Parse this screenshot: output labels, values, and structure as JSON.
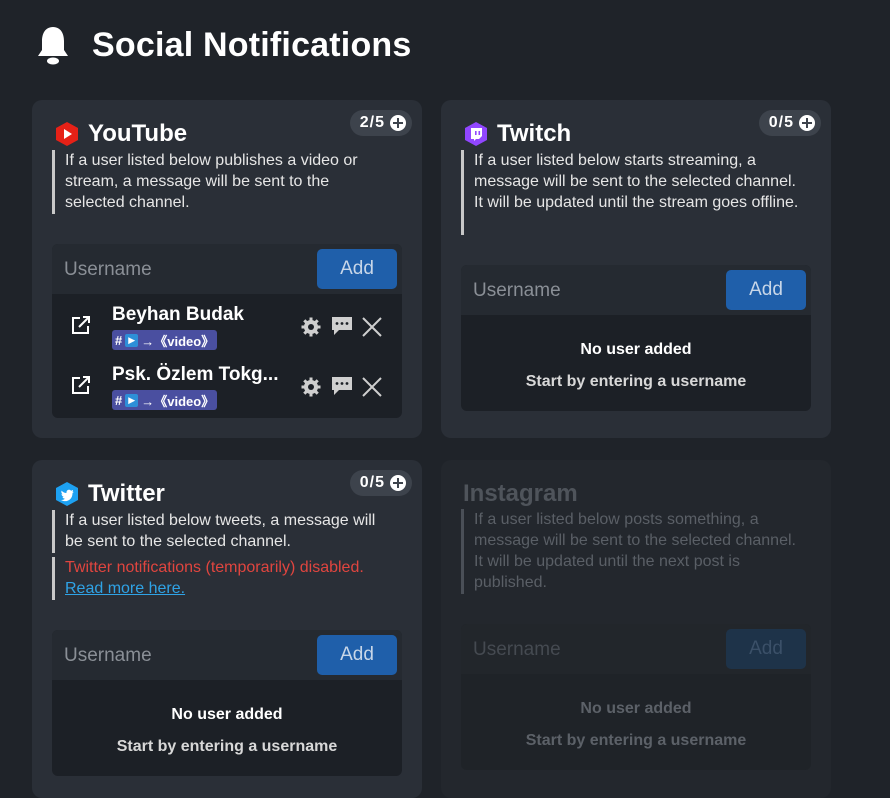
{
  "page": {
    "title": "Social Notifications"
  },
  "common": {
    "placeholder": "Username",
    "add_label": "Add",
    "empty_title": "No user added",
    "empty_hint": "Start by entering a username"
  },
  "youtube": {
    "name": "YouTube",
    "counter": "2/5",
    "desc": "If a user listed below publishes a video or stream, a message will be sent to the selected channel.",
    "users": [
      {
        "name": "Beyhan Budak",
        "channel": "→《video》"
      },
      {
        "name": "Psk. Özlem Tokg...",
        "channel": "→《video》"
      }
    ]
  },
  "twitch": {
    "name": "Twitch",
    "counter": "0/5",
    "desc": "If a user listed below starts streaming, a message will be sent to the selected channel. It will be updated until the stream goes offline."
  },
  "twitter": {
    "name": "Twitter",
    "counter": "0/5",
    "desc": "If a user listed below tweets, a message will be sent to the selected channel.",
    "warning": "Twitter notifications (temporarily) disabled.",
    "link": "Read more here."
  },
  "instagram": {
    "name": "Instagram",
    "desc": "If a user listed below posts something, a message will be sent to the selected channel. It will be updated until the next post is published."
  },
  "colors": {
    "background": "#1f2329",
    "card": "#2a2f37",
    "accent_button": "#1f5faa",
    "youtube": "#e62117",
    "twitch": "#9146ff",
    "twitter": "#1da1f2",
    "warning": "#e0453f",
    "link": "#2fa3e6"
  }
}
